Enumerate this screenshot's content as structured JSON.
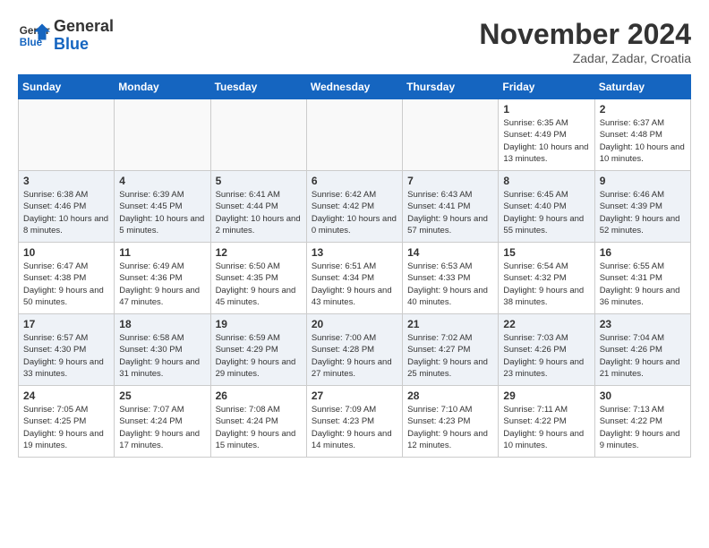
{
  "header": {
    "logo_general": "General",
    "logo_blue": "Blue",
    "month_title": "November 2024",
    "location": "Zadar, Zadar, Croatia"
  },
  "days_of_week": [
    "Sunday",
    "Monday",
    "Tuesday",
    "Wednesday",
    "Thursday",
    "Friday",
    "Saturday"
  ],
  "weeks": [
    [
      {
        "day": "",
        "info": ""
      },
      {
        "day": "",
        "info": ""
      },
      {
        "day": "",
        "info": ""
      },
      {
        "day": "",
        "info": ""
      },
      {
        "day": "",
        "info": ""
      },
      {
        "day": "1",
        "info": "Sunrise: 6:35 AM\nSunset: 4:49 PM\nDaylight: 10 hours and 13 minutes."
      },
      {
        "day": "2",
        "info": "Sunrise: 6:37 AM\nSunset: 4:48 PM\nDaylight: 10 hours and 10 minutes."
      }
    ],
    [
      {
        "day": "3",
        "info": "Sunrise: 6:38 AM\nSunset: 4:46 PM\nDaylight: 10 hours and 8 minutes."
      },
      {
        "day": "4",
        "info": "Sunrise: 6:39 AM\nSunset: 4:45 PM\nDaylight: 10 hours and 5 minutes."
      },
      {
        "day": "5",
        "info": "Sunrise: 6:41 AM\nSunset: 4:44 PM\nDaylight: 10 hours and 2 minutes."
      },
      {
        "day": "6",
        "info": "Sunrise: 6:42 AM\nSunset: 4:42 PM\nDaylight: 10 hours and 0 minutes."
      },
      {
        "day": "7",
        "info": "Sunrise: 6:43 AM\nSunset: 4:41 PM\nDaylight: 9 hours and 57 minutes."
      },
      {
        "day": "8",
        "info": "Sunrise: 6:45 AM\nSunset: 4:40 PM\nDaylight: 9 hours and 55 minutes."
      },
      {
        "day": "9",
        "info": "Sunrise: 6:46 AM\nSunset: 4:39 PM\nDaylight: 9 hours and 52 minutes."
      }
    ],
    [
      {
        "day": "10",
        "info": "Sunrise: 6:47 AM\nSunset: 4:38 PM\nDaylight: 9 hours and 50 minutes."
      },
      {
        "day": "11",
        "info": "Sunrise: 6:49 AM\nSunset: 4:36 PM\nDaylight: 9 hours and 47 minutes."
      },
      {
        "day": "12",
        "info": "Sunrise: 6:50 AM\nSunset: 4:35 PM\nDaylight: 9 hours and 45 minutes."
      },
      {
        "day": "13",
        "info": "Sunrise: 6:51 AM\nSunset: 4:34 PM\nDaylight: 9 hours and 43 minutes."
      },
      {
        "day": "14",
        "info": "Sunrise: 6:53 AM\nSunset: 4:33 PM\nDaylight: 9 hours and 40 minutes."
      },
      {
        "day": "15",
        "info": "Sunrise: 6:54 AM\nSunset: 4:32 PM\nDaylight: 9 hours and 38 minutes."
      },
      {
        "day": "16",
        "info": "Sunrise: 6:55 AM\nSunset: 4:31 PM\nDaylight: 9 hours and 36 minutes."
      }
    ],
    [
      {
        "day": "17",
        "info": "Sunrise: 6:57 AM\nSunset: 4:30 PM\nDaylight: 9 hours and 33 minutes."
      },
      {
        "day": "18",
        "info": "Sunrise: 6:58 AM\nSunset: 4:30 PM\nDaylight: 9 hours and 31 minutes."
      },
      {
        "day": "19",
        "info": "Sunrise: 6:59 AM\nSunset: 4:29 PM\nDaylight: 9 hours and 29 minutes."
      },
      {
        "day": "20",
        "info": "Sunrise: 7:00 AM\nSunset: 4:28 PM\nDaylight: 9 hours and 27 minutes."
      },
      {
        "day": "21",
        "info": "Sunrise: 7:02 AM\nSunset: 4:27 PM\nDaylight: 9 hours and 25 minutes."
      },
      {
        "day": "22",
        "info": "Sunrise: 7:03 AM\nSunset: 4:26 PM\nDaylight: 9 hours and 23 minutes."
      },
      {
        "day": "23",
        "info": "Sunrise: 7:04 AM\nSunset: 4:26 PM\nDaylight: 9 hours and 21 minutes."
      }
    ],
    [
      {
        "day": "24",
        "info": "Sunrise: 7:05 AM\nSunset: 4:25 PM\nDaylight: 9 hours and 19 minutes."
      },
      {
        "day": "25",
        "info": "Sunrise: 7:07 AM\nSunset: 4:24 PM\nDaylight: 9 hours and 17 minutes."
      },
      {
        "day": "26",
        "info": "Sunrise: 7:08 AM\nSunset: 4:24 PM\nDaylight: 9 hours and 15 minutes."
      },
      {
        "day": "27",
        "info": "Sunrise: 7:09 AM\nSunset: 4:23 PM\nDaylight: 9 hours and 14 minutes."
      },
      {
        "day": "28",
        "info": "Sunrise: 7:10 AM\nSunset: 4:23 PM\nDaylight: 9 hours and 12 minutes."
      },
      {
        "day": "29",
        "info": "Sunrise: 7:11 AM\nSunset: 4:22 PM\nDaylight: 9 hours and 10 minutes."
      },
      {
        "day": "30",
        "info": "Sunrise: 7:13 AM\nSunset: 4:22 PM\nDaylight: 9 hours and 9 minutes."
      }
    ]
  ]
}
